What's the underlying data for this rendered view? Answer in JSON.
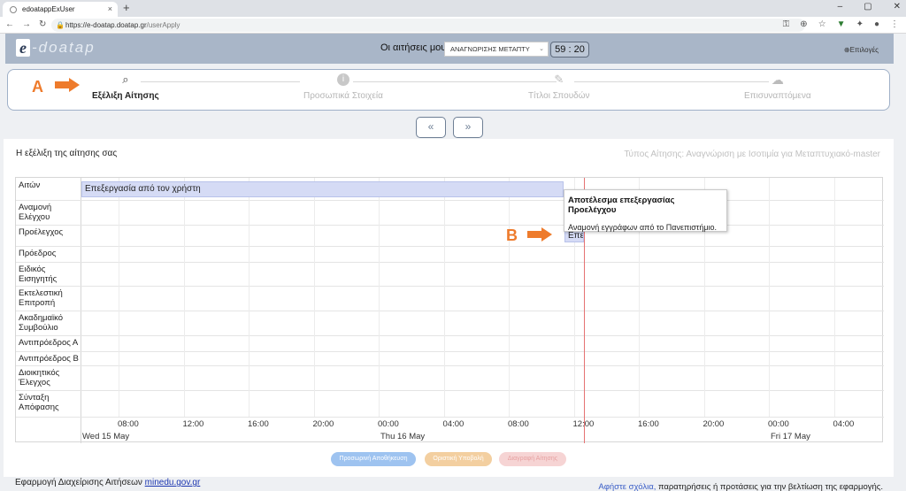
{
  "browser": {
    "tab_title": "edoatappExUser",
    "tab_close": "×",
    "new_tab": "+",
    "window_controls": [
      "–",
      "▢",
      "✕"
    ],
    "nav": [
      "←",
      "→",
      "↻"
    ],
    "url_host": "https://e-doatap.doatap.gr",
    "url_path": "/userApply",
    "icons": [
      "key-icon",
      "zoom-icon",
      "star-icon",
      "extension-icon",
      "puzzle-icon",
      "profile-icon",
      "menu-icon"
    ]
  },
  "header": {
    "logo_letter": "e",
    "logo_text": "-doatap",
    "my_apps_label": "Οι αιτήσεις μου",
    "app_select_value": "ΑΝΑΓΝΩΡΙΣΗΣ ΜΕΤΑΠΤΥ",
    "timer": "59 : 20",
    "options": "⊕Επιλογές"
  },
  "steps": [
    {
      "label": "Εξέλιξη Αίτησης",
      "icon": "search-icon",
      "glyph": "⌕"
    },
    {
      "label": "Προσωπικά Στοιχεία",
      "icon": "info-icon",
      "glyph": "i"
    },
    {
      "label": "Τίτλοι Σπουδών",
      "icon": "pencil-icon",
      "glyph": "✎"
    },
    {
      "label": "Επισυναπτόμενα",
      "icon": "cloud-upload-icon",
      "glyph": "☁"
    }
  ],
  "annotations": {
    "a": "A",
    "b": "B",
    "color": "#ee7b2c"
  },
  "pager": {
    "prev": "«",
    "next": "»"
  },
  "panel": {
    "title": "Η εξέλιξη της αίτησης σας",
    "app_type": "Τύπος Αίτησης: Αναγνώριση με Ισοτιμία για Μεταπτυχιακό-master"
  },
  "timeline": {
    "rows": [
      "Αιτών",
      "Αναμονή Ελέγχου",
      "Προέλεγχος",
      "Πρόεδρος",
      "Ειδικός Εισηγητής",
      "Εκτελεστική Επιτροπή",
      "Ακαδημαϊκό Συμβούλιο",
      "Αντιπρόεδρος Α",
      "Αντιπρόεδρος Β",
      "Διοικητικός Έλεγχος",
      "Σύνταξη Απόφασης"
    ],
    "ticks": [
      "08:00",
      "12:00",
      "16:00",
      "20:00",
      "00:00",
      "04:00",
      "08:00",
      "12:00",
      "16:00",
      "20:00",
      "00:00",
      "04:00"
    ],
    "days": [
      "Wed 15 May",
      "Thu 16 May",
      "Fri 17 May"
    ],
    "bars": [
      {
        "row": "Αιτών",
        "label": "Επεξεργασία από τον χρήστη"
      },
      {
        "row": "Προέλεγχος",
        "label": "Επεξ"
      }
    ],
    "now_color": "#e57373",
    "tooltip": {
      "title": "Αποτέλεσμα επεξεργασίας Προελέγχου",
      "text": "Αναμονή εγγράφων από το Πανεπιστήμιο."
    }
  },
  "buttons": [
    {
      "label": "Προσωρινή Αποθήκευση",
      "color": "#9ec3f0"
    },
    {
      "label": "Οριστική Υποβολή",
      "color": "#f3cfa0"
    },
    {
      "label": "Διαγραφή Αίτησης",
      "color": "#f6d4d4"
    }
  ],
  "footer": {
    "left_text": "Εφαρμογή Διαχείρισης Αιτήσεων ",
    "left_link": "minedu.gov.gr",
    "right_link": "Αφήστε σχόλια,",
    "right_text": " παρατηρήσεις ή προτάσεις για την βελτίωση της εφαρμογής."
  }
}
